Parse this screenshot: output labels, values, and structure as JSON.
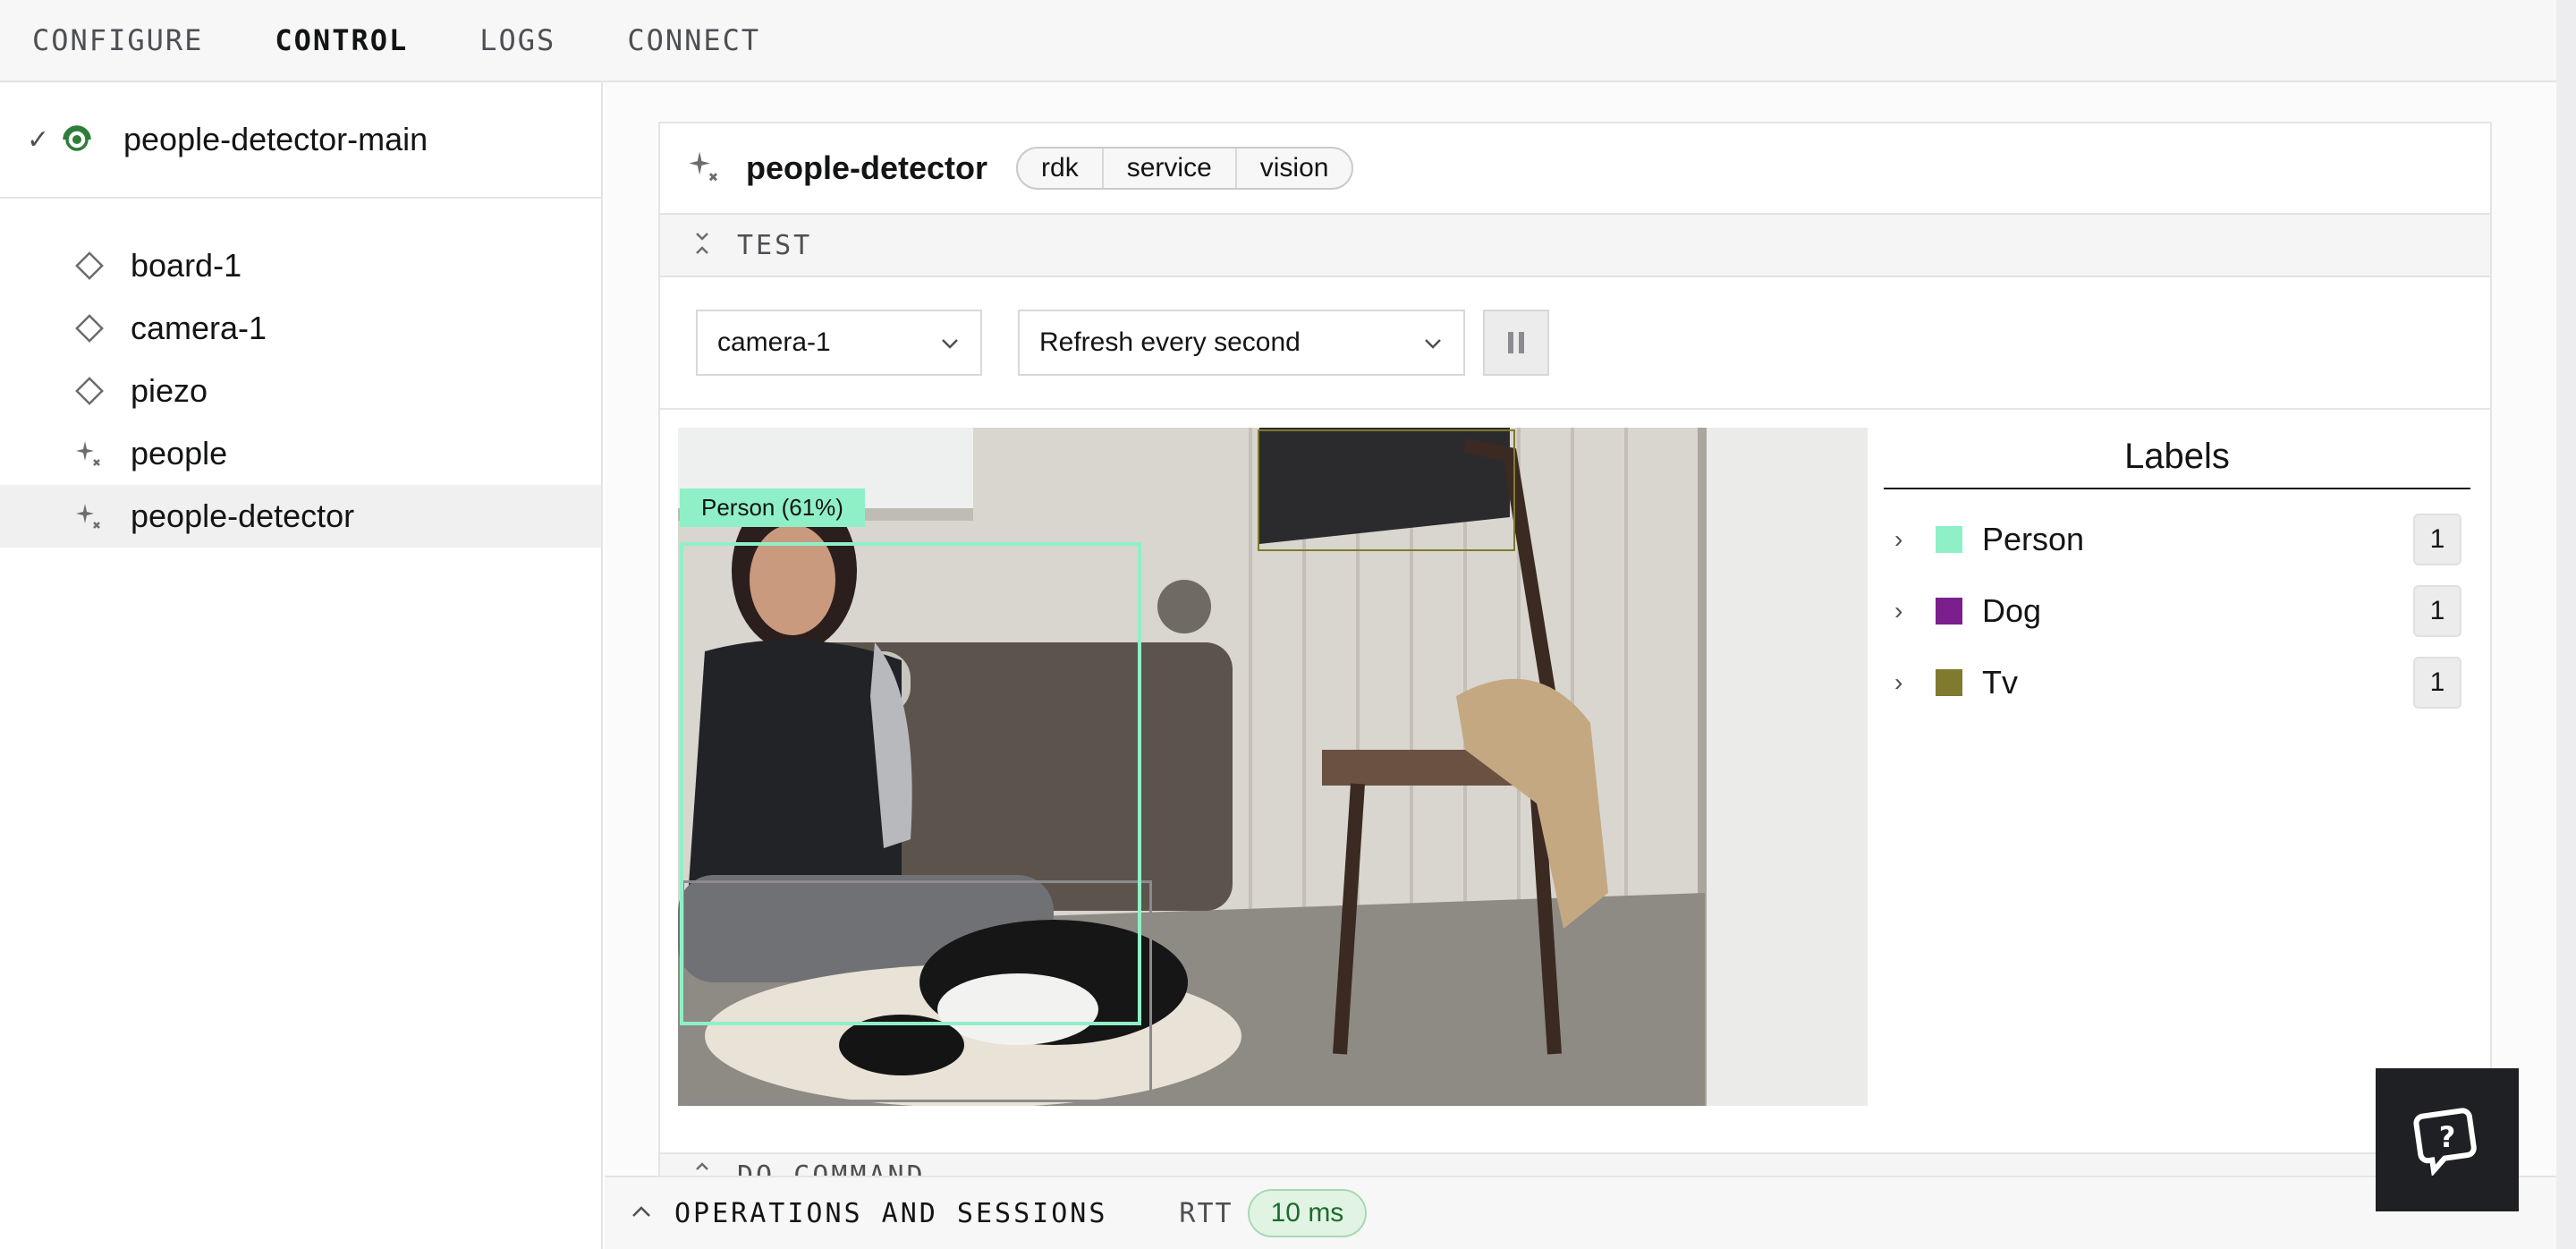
{
  "nav": {
    "tabs": [
      {
        "label": "CONFIGURE"
      },
      {
        "label": "CONTROL"
      },
      {
        "label": "LOGS"
      },
      {
        "label": "CONNECT"
      }
    ],
    "active": "CONTROL"
  },
  "sidebar": {
    "machine": {
      "name": "people-detector-main",
      "status_icon": "check-icon",
      "live_icon": "live-signal-icon"
    },
    "resources": [
      {
        "label": "board-1",
        "icon": "component-diamond-icon"
      },
      {
        "label": "camera-1",
        "icon": "component-diamond-icon"
      },
      {
        "label": "piezo",
        "icon": "component-diamond-icon"
      },
      {
        "label": "people",
        "icon": "service-sparkle-icon"
      },
      {
        "label": "people-detector",
        "icon": "service-sparkle-icon",
        "selected": true
      }
    ]
  },
  "card": {
    "title": "people-detector",
    "breadcrumbs": [
      "rdk",
      "service",
      "vision"
    ],
    "test_section": "TEST",
    "camera_select": "camera-1",
    "refresh_select": "Refresh every second",
    "do_command_section": "DO COMMAND"
  },
  "detections": [
    {
      "label": "Person (61%)",
      "color": "#8ff0c8"
    }
  ],
  "labels_panel": {
    "title": "Labels",
    "items": [
      {
        "name": "Person",
        "count": "1",
        "color": "#8ff0c8"
      },
      {
        "name": "Dog",
        "count": "1",
        "color": "#7b1f8e"
      },
      {
        "name": "Tv",
        "count": "1",
        "color": "#7f7a2e"
      }
    ]
  },
  "bottom": {
    "ops_label": "OPERATIONS AND SESSIONS",
    "rtt_label": "RTT",
    "rtt_value": "10 ms"
  }
}
